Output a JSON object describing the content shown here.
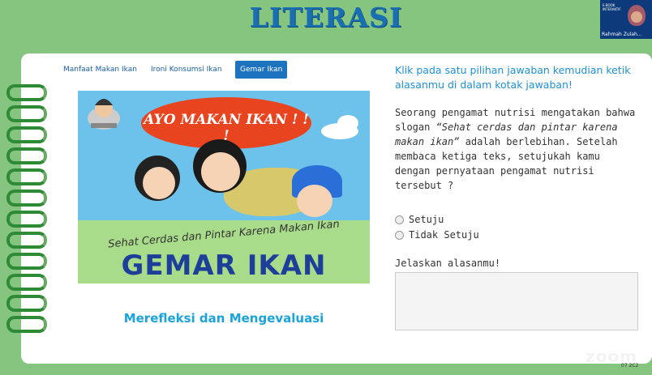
{
  "page": {
    "title": "LITERASI"
  },
  "participant": {
    "name": "Rahmah Zulah...",
    "logo_text": "E-BOOK INTERAKTIF"
  },
  "tabs": [
    {
      "label": "Manfaat Makan Ikan",
      "active": false
    },
    {
      "label": "Ironi Konsumsi Ikan",
      "active": false
    },
    {
      "label": "Gemar Ikan",
      "active": true
    }
  ],
  "banner": {
    "bubble_text": "AYO MAKAN IKAN ! ! !",
    "slogan": "Sehat Cerdas dan Pintar Karena Makan Ikan",
    "headline": "GEMAR IKAN"
  },
  "reflection_label": "Merefleksi dan Mengevaluasi",
  "instruction": "Klik pada satu pilihan jawaban kemudian ketik alasanmu di dalam kotak jawaban!",
  "question": {
    "intro": "Seorang pengamat nutrisi mengatakan bahwa slogan ",
    "quote": "“Sehat cerdas dan pintar karena makan ikan”",
    "rest": " adalah berlebihan. Setelah membaca ketiga teks, setujukah kamu dengan pernyataan pengamat nutrisi tersebut ?"
  },
  "options": [
    "Setuju",
    "Tidak Setuju"
  ],
  "explain_label": "Jelaskan alasanmu!",
  "answer_value": "",
  "watermark": "zoom",
  "corner_text": "07 2C2",
  "colors": {
    "accent": "#1e73be",
    "background": "#86c57f",
    "title": "#1a6fb3",
    "reflect": "#1ba3dc"
  },
  "icons": [
    "spiral-ring-icon",
    "chef-mascot-icon",
    "radio-icon"
  ]
}
